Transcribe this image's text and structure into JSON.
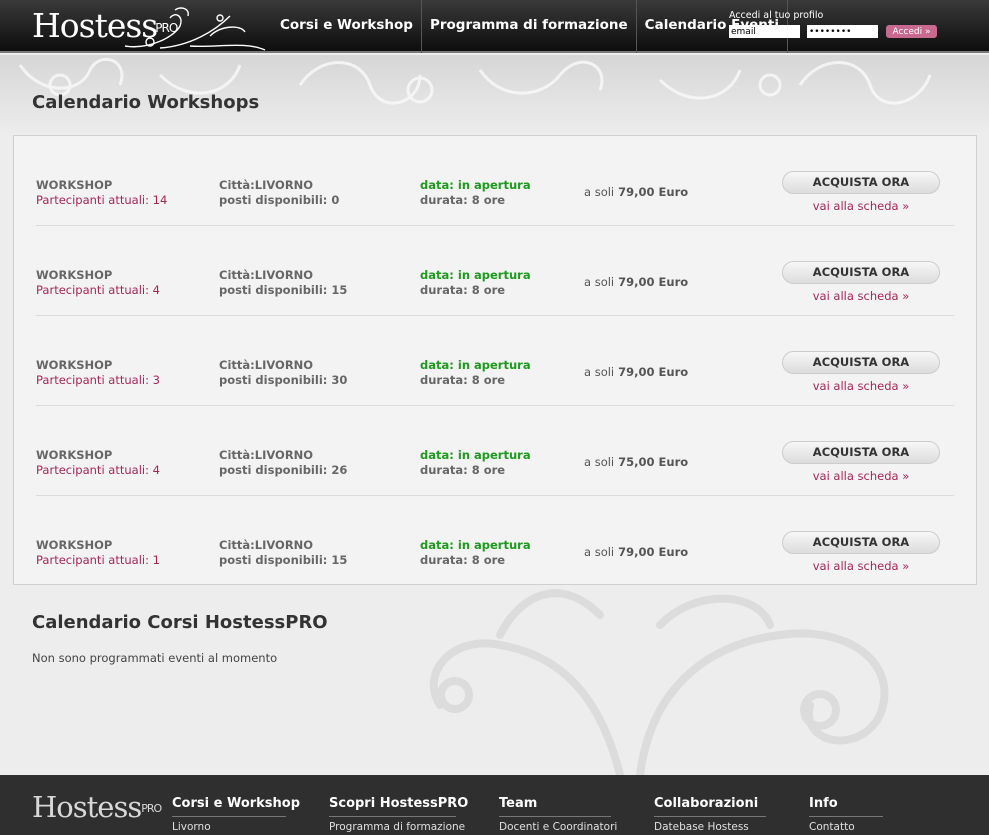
{
  "header": {
    "logo_text": "Hostess",
    "logo_sup": "PRO",
    "nav": [
      "Corsi e Workshop",
      "Programma di formazione",
      "Calendario Eventi"
    ],
    "login_label": "Accedi al tuo profilo",
    "email_value": "email",
    "password_value": "••••••••",
    "login_button": "Accedi »"
  },
  "workshops": {
    "title": "Calendario Workshops",
    "rows": [
      {
        "type": "WORKSHOP",
        "participants_label": "Partecipanti attuali:",
        "participants": "14",
        "city_label": "Città:",
        "city": "LIVORNO",
        "posti_label": "posti disponibili:",
        "posti": "0",
        "data_label": "data:",
        "data": "in apertura",
        "durata_label": "durata:",
        "durata": "8 ore",
        "price_label": "a soli",
        "price": "79,00 Euro",
        "buy": "ACQUISTA ORA",
        "link": "vai alla scheda »"
      },
      {
        "type": "WORKSHOP",
        "participants_label": "Partecipanti attuali:",
        "participants": "4",
        "city_label": "Città:",
        "city": "LIVORNO",
        "posti_label": "posti disponibili:",
        "posti": "15",
        "data_label": "data:",
        "data": "in apertura",
        "durata_label": "durata:",
        "durata": "8 ore",
        "price_label": "a soli",
        "price": "79,00 Euro",
        "buy": "ACQUISTA ORA",
        "link": "vai alla scheda »"
      },
      {
        "type": "WORKSHOP",
        "participants_label": "Partecipanti attuali:",
        "participants": "3",
        "city_label": "Città:",
        "city": "LIVORNO",
        "posti_label": "posti disponibili:",
        "posti": "30",
        "data_label": "data:",
        "data": "in apertura",
        "durata_label": "durata:",
        "durata": "8 ore",
        "price_label": "a soli",
        "price": "79,00 Euro",
        "buy": "ACQUISTA ORA",
        "link": "vai alla scheda »"
      },
      {
        "type": "WORKSHOP",
        "participants_label": "Partecipanti attuali:",
        "participants": "4",
        "city_label": "Città:",
        "city": "LIVORNO",
        "posti_label": "posti disponibili:",
        "posti": "26",
        "data_label": "data:",
        "data": "in apertura",
        "durata_label": "durata:",
        "durata": "8 ore",
        "price_label": "a soli",
        "price": "75,00 Euro",
        "buy": "ACQUISTA ORA",
        "link": "vai alla scheda »"
      },
      {
        "type": "WORKSHOP",
        "participants_label": "Partecipanti attuali:",
        "participants": "1",
        "city_label": "Città:",
        "city": "LIVORNO",
        "posti_label": "posti disponibili:",
        "posti": "15",
        "data_label": "data:",
        "data": "in apertura",
        "durata_label": "durata:",
        "durata": "8 ore",
        "price_label": "a soli",
        "price": "79,00 Euro",
        "buy": "ACQUISTA ORA",
        "link": "vai alla scheda »"
      }
    ]
  },
  "courses": {
    "title": "Calendario Corsi HostessPRO",
    "empty_message": "Non sono programmati eventi al momento"
  },
  "footer": {
    "logo_text": "Hostess",
    "logo_sup": "PRO",
    "columns": [
      {
        "head": "Corsi e Workshop",
        "link": "Livorno"
      },
      {
        "head": "Scopri HostessPRO",
        "link": "Programma di formazione"
      },
      {
        "head": "Team",
        "link": "Docenti e Coordinatori"
      },
      {
        "head": "Collaborazioni",
        "link": "Datebase Hostess"
      },
      {
        "head": "Info",
        "link": "Contatto"
      }
    ]
  },
  "colors": {
    "accent_pink": "#a3285a",
    "status_green": "#1e9a1e",
    "header_dark": "#0d0d0d"
  }
}
